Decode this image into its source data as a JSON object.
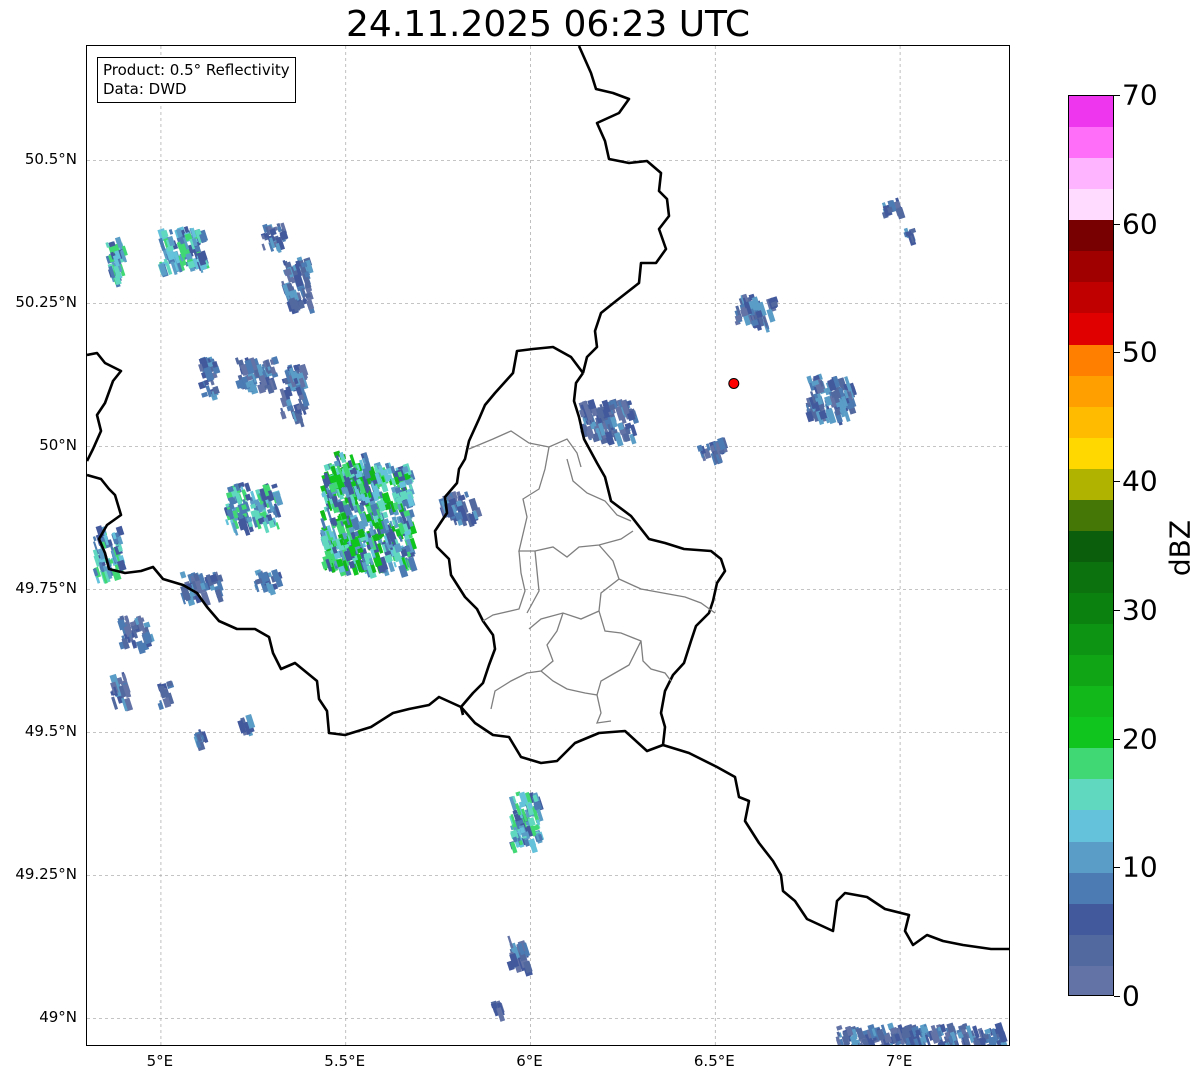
{
  "title": "24.11.2025 06:23 UTC",
  "info_box": {
    "product": "Product: 0.5° Reflectivity",
    "data": "Data: DWD"
  },
  "map": {
    "lon_range": [
      4.8,
      7.3
    ],
    "lat_range": [
      48.95,
      50.7
    ],
    "gridlines": true,
    "lat_ticks": [
      {
        "value": 50.5,
        "label": "50.5°N"
      },
      {
        "value": 50.25,
        "label": "50.25°N"
      },
      {
        "value": 50.0,
        "label": "50°N"
      },
      {
        "value": 49.75,
        "label": "49.75°N"
      },
      {
        "value": 49.5,
        "label": "49.5°N"
      },
      {
        "value": 49.25,
        "label": "49.25°N"
      },
      {
        "value": 49.0,
        "label": "49°N"
      }
    ],
    "lon_ticks": [
      {
        "value": 5.0,
        "label": "5°E"
      },
      {
        "value": 5.5,
        "label": "5.5°E"
      },
      {
        "value": 6.0,
        "label": "6°E"
      },
      {
        "value": 6.5,
        "label": "6.5°E"
      },
      {
        "value": 7.0,
        "label": "7°E"
      }
    ],
    "radar_site": {
      "lon": 6.55,
      "lat": 50.11,
      "color": "#ff0000"
    },
    "echoes": [
      {
        "lon": 4.87,
        "lat": 50.33,
        "w": 0.05,
        "h": 0.07,
        "level": "mixed"
      },
      {
        "lon": 5.05,
        "lat": 50.35,
        "w": 0.12,
        "h": 0.07,
        "level": "mixed"
      },
      {
        "lon": 5.3,
        "lat": 50.37,
        "w": 0.06,
        "h": 0.04,
        "level": "light"
      },
      {
        "lon": 5.36,
        "lat": 50.29,
        "w": 0.07,
        "h": 0.08,
        "level": "light"
      },
      {
        "lon": 5.12,
        "lat": 50.12,
        "w": 0.04,
        "h": 0.07,
        "level": "light"
      },
      {
        "lon": 5.25,
        "lat": 50.13,
        "w": 0.1,
        "h": 0.05,
        "level": "light"
      },
      {
        "lon": 5.35,
        "lat": 50.1,
        "w": 0.06,
        "h": 0.09,
        "level": "light"
      },
      {
        "lon": 5.55,
        "lat": 49.88,
        "w": 0.24,
        "h": 0.18,
        "level": "moderate"
      },
      {
        "lon": 5.5,
        "lat": 49.95,
        "w": 0.1,
        "h": 0.08,
        "level": "moderate"
      },
      {
        "lon": 5.24,
        "lat": 49.9,
        "w": 0.14,
        "h": 0.07,
        "level": "mixed"
      },
      {
        "lon": 5.8,
        "lat": 49.9,
        "w": 0.1,
        "h": 0.04,
        "level": "light"
      },
      {
        "lon": 4.85,
        "lat": 49.82,
        "w": 0.07,
        "h": 0.08,
        "level": "mixed"
      },
      {
        "lon": 5.1,
        "lat": 49.76,
        "w": 0.1,
        "h": 0.04,
        "level": "light"
      },
      {
        "lon": 5.28,
        "lat": 49.77,
        "w": 0.06,
        "h": 0.03,
        "level": "light"
      },
      {
        "lon": 4.92,
        "lat": 49.68,
        "w": 0.08,
        "h": 0.05,
        "level": "light"
      },
      {
        "lon": 4.88,
        "lat": 49.58,
        "w": 0.04,
        "h": 0.05,
        "level": "light"
      },
      {
        "lon": 5.0,
        "lat": 49.57,
        "w": 0.03,
        "h": 0.04,
        "level": "light"
      },
      {
        "lon": 5.1,
        "lat": 49.49,
        "w": 0.03,
        "h": 0.03,
        "level": "light"
      },
      {
        "lon": 5.22,
        "lat": 49.52,
        "w": 0.03,
        "h": 0.02,
        "level": "light"
      },
      {
        "lon": 5.98,
        "lat": 49.35,
        "w": 0.08,
        "h": 0.09,
        "level": "mixed"
      },
      {
        "lon": 5.96,
        "lat": 49.12,
        "w": 0.05,
        "h": 0.05,
        "level": "light"
      },
      {
        "lon": 5.9,
        "lat": 49.02,
        "w": 0.03,
        "h": 0.02,
        "level": "light"
      },
      {
        "lon": 6.8,
        "lat": 50.09,
        "w": 0.12,
        "h": 0.07,
        "level": "light"
      },
      {
        "lon": 6.2,
        "lat": 50.05,
        "w": 0.14,
        "h": 0.06,
        "level": "light"
      },
      {
        "lon": 6.6,
        "lat": 50.24,
        "w": 0.1,
        "h": 0.05,
        "level": "light"
      },
      {
        "lon": 6.48,
        "lat": 50.0,
        "w": 0.07,
        "h": 0.03,
        "level": "light"
      },
      {
        "lon": 6.97,
        "lat": 50.42,
        "w": 0.04,
        "h": 0.03,
        "level": "light"
      },
      {
        "lon": 7.02,
        "lat": 50.38,
        "w": 0.03,
        "h": 0.02,
        "level": "light"
      },
      {
        "lon": 7.05,
        "lat": 48.97,
        "w": 0.45,
        "h": 0.04,
        "level": "light"
      }
    ]
  },
  "colorbar": {
    "label": "dBZ",
    "min": 0,
    "max": 70,
    "step": 5,
    "ticks": [
      {
        "value": 70,
        "label": "70"
      },
      {
        "value": 60,
        "label": "60"
      },
      {
        "value": 50,
        "label": "50"
      },
      {
        "value": 40,
        "label": "40"
      },
      {
        "value": 30,
        "label": "30"
      },
      {
        "value": 20,
        "label": "20"
      },
      {
        "value": 10,
        "label": "10"
      },
      {
        "value": 0,
        "label": "0"
      }
    ],
    "colors": [
      "#6373a5",
      "#52699f",
      "#42599c",
      "#4b7bb2",
      "#5a9dc6",
      "#64c2db",
      "#60d8c0",
      "#40d874",
      "#10c61e",
      "#12b81a",
      "#10a515",
      "#0d9412",
      "#0b820f",
      "#0b720d",
      "#0b5e0b",
      "#447705",
      "#b0b400",
      "#ffd800",
      "#ffbb00",
      "#ff9f00",
      "#ff7f00",
      "#e00000",
      "#c00000",
      "#a00000",
      "#780000",
      "#ffdcff",
      "#ffb4ff",
      "#ff6ef8",
      "#ee36ee"
    ]
  }
}
